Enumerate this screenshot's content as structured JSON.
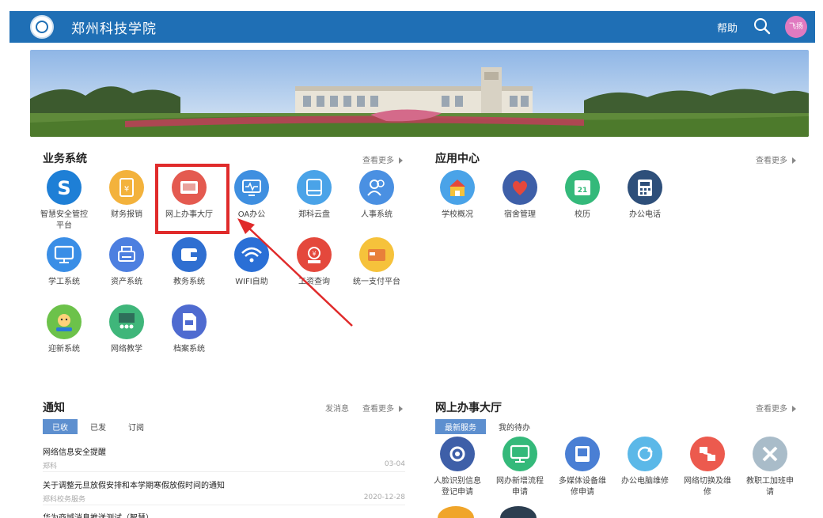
{
  "header": {
    "site_title": "郑州科技学院",
    "help_label": "帮助",
    "avatar_text": "飞扬"
  },
  "business": {
    "title": "业务系统",
    "more": "查看更多",
    "apps": [
      {
        "label": "智慧安全管控平台",
        "icon": "s-shield-icon",
        "color": "#1e7fd6"
      },
      {
        "label": "财务报销",
        "icon": "receipt-yen-icon",
        "color": "#f3b23c"
      },
      {
        "label": "网上办事大厅",
        "icon": "tablet-icon",
        "color": "#e45a50"
      },
      {
        "label": "OA办公",
        "icon": "monitor-wave-icon",
        "color": "#3f8fe0"
      },
      {
        "label": "郑科云盘",
        "icon": "cloud-disk-icon",
        "color": "#4aa3e8"
      },
      {
        "label": "人事系统",
        "icon": "people-icon",
        "color": "#4a90e2"
      },
      {
        "label": "学工系统",
        "icon": "monitor-icon",
        "color": "#3a8ee6"
      },
      {
        "label": "资产系统",
        "icon": "printer-icon",
        "color": "#4d7fe0"
      },
      {
        "label": "教务系统",
        "icon": "wallet-icon",
        "color": "#2f6fd1"
      },
      {
        "label": "WIFI自助",
        "icon": "wifi-icon",
        "color": "#2a6fd6"
      },
      {
        "label": "工资查询",
        "icon": "salary-icon",
        "color": "#e4483c"
      },
      {
        "label": "统一支付平台",
        "icon": "payment-card-icon",
        "color": "#f6c23b"
      },
      {
        "label": "迎新系统",
        "icon": "welcome-kid-icon",
        "color": "#6cc24a"
      },
      {
        "label": "网络教学",
        "icon": "classroom-icon",
        "color": "#3fb67a"
      },
      {
        "label": "档案系统",
        "icon": "file-icon",
        "color": "#4f6bd0"
      }
    ]
  },
  "app_center": {
    "title": "应用中心",
    "more": "查看更多",
    "apps": [
      {
        "label": "学校概况",
        "icon": "school-icon",
        "color": "#4aa3e8"
      },
      {
        "label": "宿舍管理",
        "icon": "heart-icon",
        "color": "#3e5fa8"
      },
      {
        "label": "校历",
        "icon": "calendar-icon",
        "color": "#34b97a"
      },
      {
        "label": "办公电话",
        "icon": "phone-icon",
        "color": "#2e4f7a"
      }
    ],
    "calendar_day": "21"
  },
  "notice": {
    "title": "通知",
    "post": "发消息",
    "more": "查看更多",
    "tabs": [
      "已收",
      "已发",
      "订阅"
    ],
    "items": [
      {
        "title": "网络信息安全提醒",
        "source": "郑科",
        "date": "03-04"
      },
      {
        "title": "关于调整元旦放假安排和本学期寒假放假时间的通知",
        "source": "郑科校务服务",
        "date": "2020-12-28"
      },
      {
        "title": "华为商城消息推送测试（智慧）",
        "source": "",
        "date": ""
      }
    ]
  },
  "service_hall": {
    "title": "网上办事大厅",
    "more": "查看更多",
    "tabs": [
      "最新服务",
      "我的待办"
    ],
    "apps": [
      {
        "label": "人脸识别信息登记申请",
        "icon": "gear-icon",
        "color": "#3e5fa8"
      },
      {
        "label": "网办新增流程申请",
        "icon": "monitor-icon",
        "color": "#34b97a"
      },
      {
        "label": "多媒体设备维修申请",
        "icon": "media-device-icon",
        "color": "#4a7fd4"
      },
      {
        "label": "办公电脑维修",
        "icon": "refresh-icon",
        "color": "#5bb8e8"
      },
      {
        "label": "网络切换及维修",
        "icon": "network-icon",
        "color": "#ec5a4e"
      },
      {
        "label": "教职工加班申请",
        "icon": "cross-icon",
        "color": "#a9bcc9"
      }
    ]
  }
}
